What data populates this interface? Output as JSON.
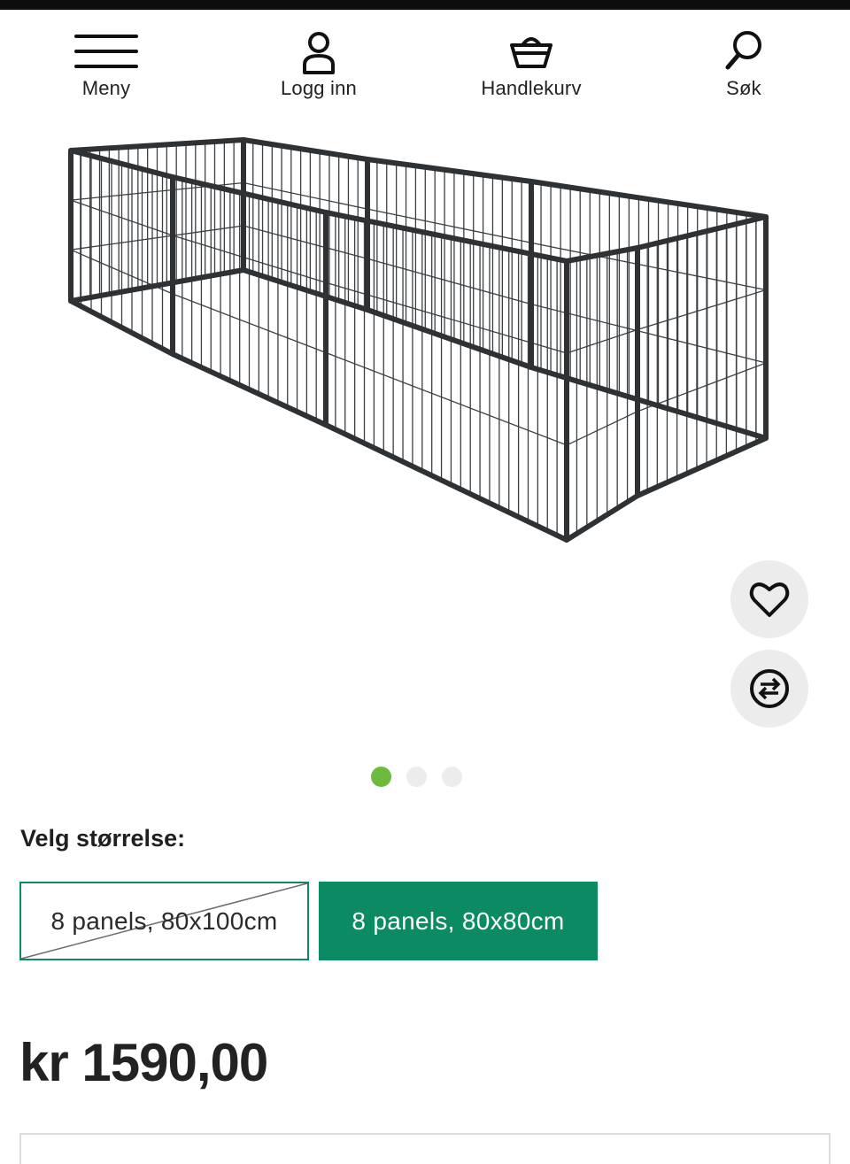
{
  "nav": {
    "menu": {
      "label": "Meny",
      "icon": "hamburger-menu-icon"
    },
    "login": {
      "label": "Logg inn",
      "icon": "user-icon"
    },
    "cart": {
      "label": "Handlekurv",
      "icon": "basket-icon"
    },
    "search": {
      "label": "Søk",
      "icon": "search-icon"
    }
  },
  "product": {
    "image_subject": "product-image-dog-playpen",
    "favorite_icon": "heart-icon",
    "compare_icon": "compare-arrows-icon",
    "carousel": {
      "count": 3,
      "active_index": 0
    }
  },
  "size": {
    "label": "Velg størrelse:",
    "options": [
      {
        "label": "8 panels, 80x100cm",
        "available": false,
        "selected": false
      },
      {
        "label": "8 panels, 80x80cm",
        "available": true,
        "selected": true
      }
    ]
  },
  "price": {
    "text": "kr 1590,00"
  },
  "colors": {
    "accent": "#0c8a64",
    "dot_active": "#6cbb3c",
    "dot_inactive": "#ececec",
    "round_button_bg": "#ececec"
  }
}
